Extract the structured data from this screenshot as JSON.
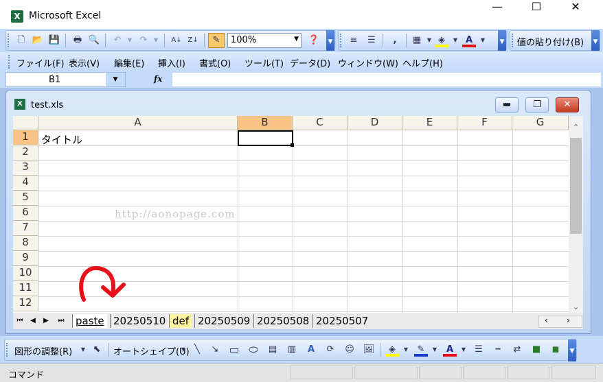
{
  "window": {
    "title": "Microsoft Excel",
    "app_icon": "X"
  },
  "caption_buttons": {
    "minimize": "—",
    "maximize": "☐",
    "close": "✕"
  },
  "standard_toolbar": {
    "zoom": "100%",
    "paste_values_label": "値の貼り付け(B)"
  },
  "menu": {
    "items": [
      "ファイル(F)",
      "表示(V)",
      "編集(E)",
      "挿入(I)",
      "書式(O)",
      "ツール(T)",
      "データ(D)",
      "ウィンドウ(W)",
      "ヘルプ(H)"
    ]
  },
  "formula_bar": {
    "name_box": "B1",
    "fx": "fx",
    "value": ""
  },
  "workbook": {
    "title": "test.xls",
    "icon": "X"
  },
  "grid": {
    "columns": [
      "A",
      "B",
      "C",
      "D",
      "E",
      "F",
      "G"
    ],
    "rows": [
      "1",
      "2",
      "3",
      "4",
      "5",
      "6",
      "7",
      "8",
      "9",
      "10",
      "11",
      "12"
    ],
    "selected_column": "B",
    "selected_row": "1",
    "cells": {
      "A1": "タイトル"
    },
    "watermark": "http://aonopage.com"
  },
  "sheet_tabs": {
    "nav": [
      "⏮",
      "◀",
      "▶",
      "⏭"
    ],
    "tabs": [
      "paste",
      "20250510",
      "def",
      "20250509",
      "20250508",
      "20250507"
    ],
    "active": "paste",
    "highlighted": "def"
  },
  "drawing_toolbar": {
    "adjust_shape": "図形の調整(R)",
    "autoshape": "オートシェイプ(U)"
  },
  "status_bar": {
    "mode": "コマンド"
  },
  "colors": {
    "toolbar_bg": "#c3daf9",
    "selected_header": "#f8c384",
    "highlight_tab": "#fff3a0",
    "annotation_red": "#e8101a"
  }
}
